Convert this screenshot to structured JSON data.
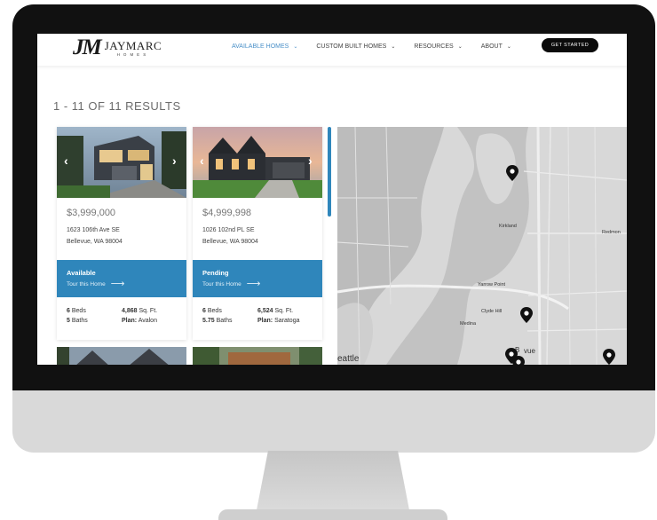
{
  "header": {
    "logo_mark": "JM",
    "logo_name": "JAYMARC",
    "logo_sub": "HOMES",
    "nav": [
      {
        "label": "AVAILABLE HOMES",
        "active": true
      },
      {
        "label": "CUSTOM BUILT HOMES",
        "active": false
      },
      {
        "label": "RESOURCES",
        "active": false
      },
      {
        "label": "ABOUT",
        "active": false
      }
    ],
    "cta": "GET STARTED"
  },
  "results": "1 - 11 OF 11 RESULTS",
  "listings": [
    {
      "price": "$3,999,000",
      "address1": "1623 106th Ave SE",
      "address2": "Bellevue, WA 98004",
      "status": "Available",
      "tour": "Tour this Home",
      "beds_num": "6",
      "beds_label": "Beds",
      "baths_num": "5",
      "baths_label": "Baths",
      "sqft_num": "4,868",
      "sqft_label": "Sq. Ft.",
      "plan_label": "Plan:",
      "plan_name": "Avalon"
    },
    {
      "price": "$4,999,998",
      "address1": "1026 102nd PL SE",
      "address2": "Bellevue, WA 98004",
      "status": "Pending",
      "tour": "Tour this Home",
      "beds_num": "6",
      "beds_label": "Beds",
      "baths_num": "5.75",
      "baths_label": "Baths",
      "sqft_num": "6,524",
      "sqft_label": "Sq. Ft.",
      "plan_label": "Plan:",
      "plan_name": "Saratoga"
    }
  ],
  "map": {
    "labels": [
      "Kirkland",
      "Redmon",
      "Yarrow Point",
      "Clyde Hill",
      "Medina",
      "B",
      "vue",
      "eattle"
    ]
  },
  "colors": {
    "accent": "#2f86bb",
    "nav_active": "#4a90c8",
    "cta_bg": "#0b0b0b",
    "map_bg": "#d8d8d8"
  },
  "icons": [
    "chevron-left-icon",
    "chevron-right-icon",
    "chevron-down-icon",
    "arrow-right-icon",
    "map-pin-icon"
  ]
}
